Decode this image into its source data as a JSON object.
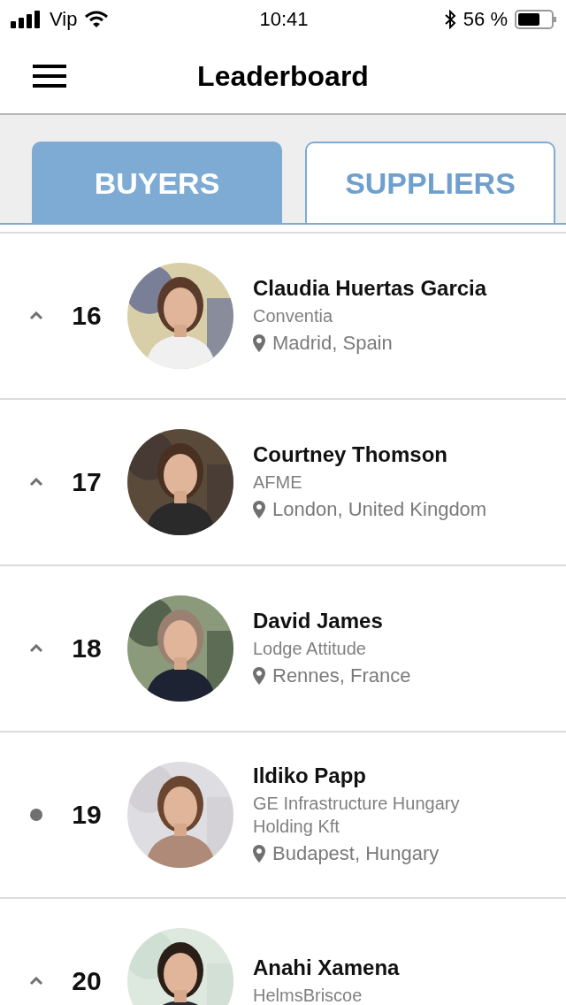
{
  "status_bar": {
    "carrier": "Vip",
    "time": "10:41",
    "battery": "56 %"
  },
  "nav": {
    "title": "Leaderboard"
  },
  "tabs": [
    {
      "label": "BUYERS",
      "selected": true
    },
    {
      "label": "SUPPLIERS",
      "selected": false
    }
  ],
  "rows": [
    {
      "kind": "up",
      "rank": "16",
      "name": "Claudia Huertas Garcia",
      "company": "Conventia",
      "location": "Madrid, Spain"
    },
    {
      "kind": "up",
      "rank": "17",
      "name": "Courtney Thomson",
      "company": "AFME",
      "location": "London, United Kingdom"
    },
    {
      "kind": "up",
      "rank": "18",
      "name": "David James",
      "company": "Lodge Attitude",
      "location": "Rennes, France"
    },
    {
      "kind": "same",
      "rank": "19",
      "name": "Ildiko Papp",
      "company": "GE Infrastructure Hungary Holding Kft",
      "location": "Budapest, Hungary"
    },
    {
      "kind": "up",
      "rank": "20",
      "name": "Anahi Xamena",
      "company": "HelmsBriscoe"
    }
  ]
}
